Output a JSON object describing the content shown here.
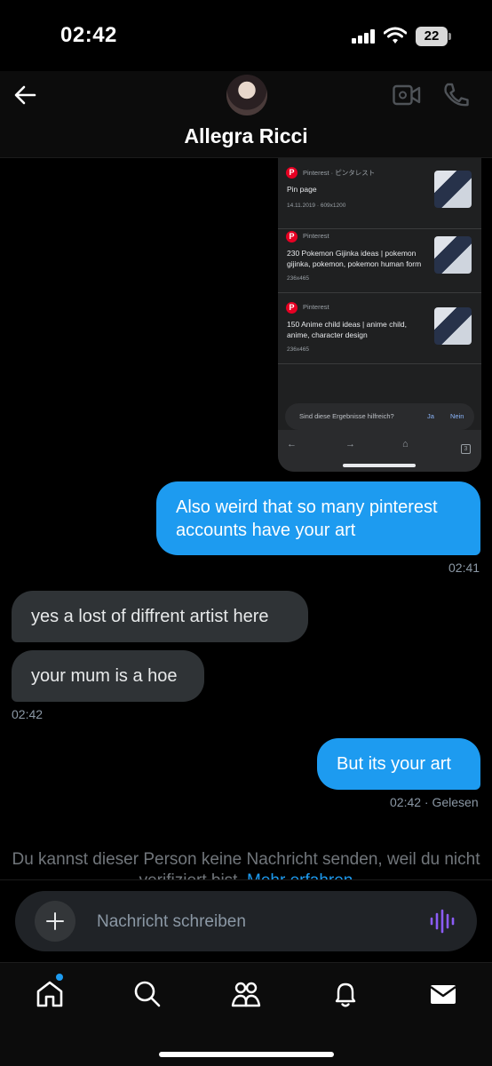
{
  "status_bar": {
    "time": "02:42",
    "battery": "22"
  },
  "header": {
    "contact_name": "Allegra Ricci"
  },
  "shared_screenshot": {
    "results": [
      {
        "source": "Pinterest · ピンタレスト",
        "title": "Pin page",
        "meta": "14.11.2019 · 609x1200"
      },
      {
        "source": "Pinterest",
        "title": "230 Pokemon Gijinka ideas | pokemon gijinka, pokemon, pokemon human form",
        "meta": "236x465"
      },
      {
        "source": "Pinterest",
        "title": "150 Anime child ideas | anime child, anime, character design",
        "meta": "236x465"
      }
    ],
    "feedback": {
      "question": "Sind diese Ergebnisse hilfreich?",
      "yes": "Ja",
      "no": "Nein"
    },
    "tab_count": "3"
  },
  "messages": [
    {
      "text": "Also weird that so many pinterest accounts have your art"
    },
    {
      "text": "yes a lost of diffrent artist here"
    },
    {
      "text": "your mum is a hoe"
    },
    {
      "text": "But its your art"
    }
  ],
  "timestamps": {
    "first": "02:41",
    "second": "02:42",
    "third": "02:42 · Gelesen"
  },
  "notice": {
    "text": "Du kannst dieser Person keine Nachricht senden, weil du nicht verifiziert bist.",
    "link": "Mehr erfahren"
  },
  "composer": {
    "placeholder": "Nachricht schreiben"
  },
  "colors": {
    "accent": "#1d9bf0",
    "incoming_bubble": "#2f3336",
    "voice_icon": "#8b5cf6",
    "background": "#000000"
  },
  "icons": [
    "back-arrow-icon",
    "video-camera-icon",
    "phone-icon",
    "plus-icon",
    "voice-waveform-icon",
    "home-icon",
    "search-icon",
    "communities-icon",
    "bell-icon",
    "mail-icon"
  ]
}
